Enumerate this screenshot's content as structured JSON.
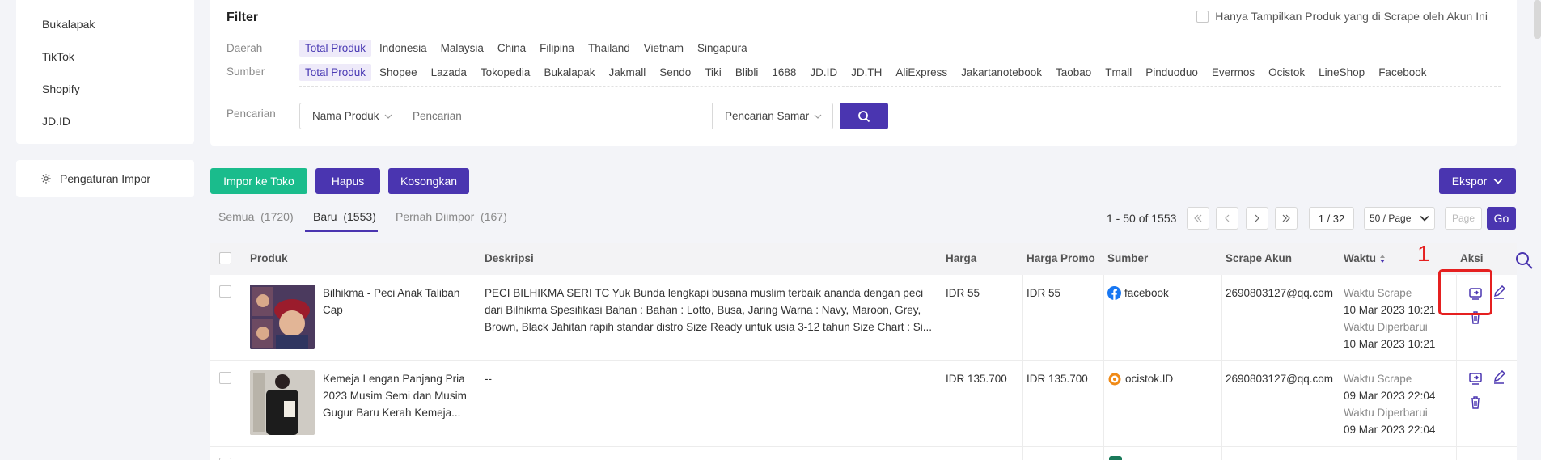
{
  "sidebar": {
    "items": [
      "Bukalapak",
      "TikTok",
      "Shopify",
      "JD.ID"
    ],
    "import_settings": "Pengaturan Impor"
  },
  "filter": {
    "title": "Filter",
    "only_mine": "Hanya Tampilkan Produk yang di Scrape oleh Akun Ini",
    "region_label": "Daerah",
    "regions": [
      "Total Produk",
      "Indonesia",
      "Malaysia",
      "China",
      "Filipina",
      "Thailand",
      "Vietnam",
      "Singapura"
    ],
    "source_label": "Sumber",
    "sources": [
      "Total Produk",
      "Shopee",
      "Lazada",
      "Tokopedia",
      "Bukalapak",
      "Jakmall",
      "Sendo",
      "Tiki",
      "Blibli",
      "1688",
      "JD.ID",
      "JD.TH",
      "AliExpress",
      "Jakartanotebook",
      "Taobao",
      "Tmall",
      "Pinduoduo",
      "Evermos",
      "Ocistok",
      "LineShop",
      "Facebook"
    ],
    "search_label": "Pencarian",
    "search_field": "Nama Produk",
    "search_placeholder": "Pencarian",
    "search_mode": "Pencarian Samar"
  },
  "actions": {
    "import": "Impor ke Toko",
    "delete": "Hapus",
    "clear": "Kosongkan",
    "export": "Ekspor"
  },
  "tabs": [
    {
      "label": "Semua",
      "count": "(1720)"
    },
    {
      "label": "Baru",
      "count": "(1553)"
    },
    {
      "label": "Pernah Diimpor",
      "count": "(167)"
    }
  ],
  "pagination": {
    "info": "1 - 50 of 1553",
    "page": "1 / 32",
    "per_page": "50 / Page",
    "page_placeholder": "Page",
    "go": "Go"
  },
  "table": {
    "headers": [
      "Produk",
      "Deskripsi",
      "Harga",
      "Harga Promo",
      "Sumber",
      "Scrape Akun",
      "Waktu",
      "Aksi"
    ],
    "rows": [
      {
        "product": "Bilhikma - Peci Anak Taliban Cap",
        "description": "PECI BILHIKMA SERI TC Yuk Bunda lengkapi busana muslim terbaik ananda dengan peci dari Bilhikma Spesifikasi Bahan : Bahan : Lotto, Busa, Jaring Warna : Navy, Maroon, Grey, Brown, Black Jahitan rapih standar distro Size Ready untuk usia 3-12 tahun Size Chart : Si...",
        "price": "IDR 55",
        "promo": "IDR 55",
        "source": "facebook",
        "account": "2690803127@qq.com",
        "scrape_label": "Waktu Scrape",
        "scrape_time": "10 Mar 2023 10:21",
        "update_label": "Waktu Diperbarui",
        "update_time": "10 Mar 2023 10:21"
      },
      {
        "product": "Kemeja Lengan Panjang Pria 2023 Musim Semi dan Musim Gugur Baru Kerah Kemeja...",
        "description": "--",
        "price": "IDR 135.700",
        "promo": "IDR 135.700",
        "source": "ocistok.ID",
        "account": "2690803127@qq.com",
        "scrape_label": "Waktu Scrape",
        "scrape_time": "09 Mar 2023 22:04",
        "update_label": "Waktu Diperbarui",
        "update_time": "09 Mar 2023 22:04"
      }
    ]
  },
  "annotation": "1",
  "colors": {
    "primary": "#4a35b0",
    "green": "#1abc8c",
    "highlight": "#e52020"
  }
}
